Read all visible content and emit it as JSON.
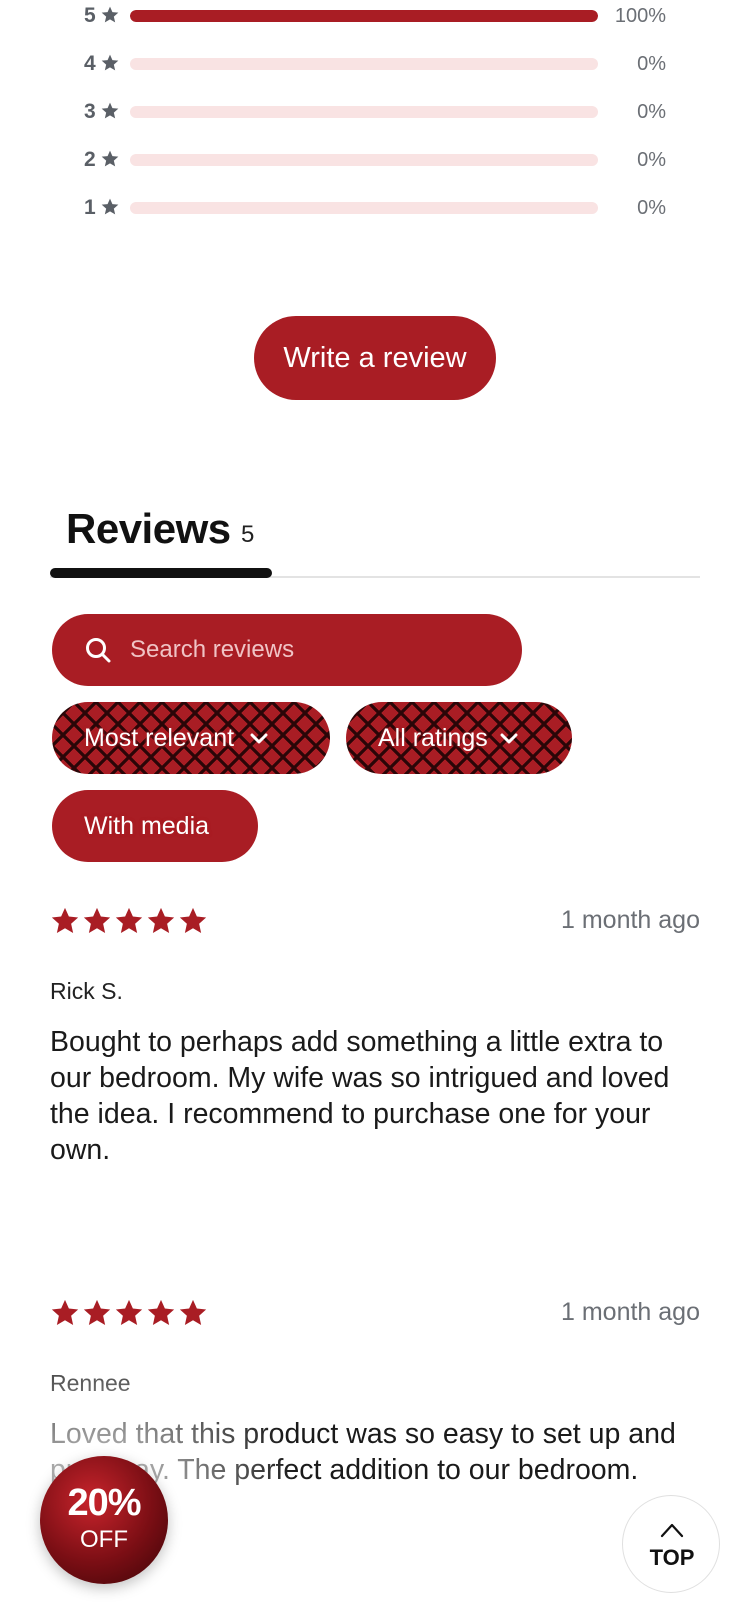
{
  "rating_distribution": [
    {
      "stars": "5",
      "percent_label": "100%",
      "fill": 1.0
    },
    {
      "stars": "4",
      "percent_label": "0%",
      "fill": 0
    },
    {
      "stars": "3",
      "percent_label": "0%",
      "fill": 0
    },
    {
      "stars": "2",
      "percent_label": "0%",
      "fill": 0
    },
    {
      "stars": "1",
      "percent_label": "0%",
      "fill": 0
    }
  ],
  "write_review_label": "Write a review",
  "reviews_tab": {
    "title": "Reviews",
    "count": "5"
  },
  "search": {
    "placeholder": "Search reviews",
    "icon": "search-icon"
  },
  "filters": {
    "sort_label": "Most relevant",
    "rating_label": "All ratings",
    "media_label": "With media"
  },
  "reviews": [
    {
      "rating": 5,
      "date": "1 month ago",
      "author": "Rick S.",
      "body": "Bought to perhaps add something a little extra to our bedroom. My wife was so intrigued and loved the idea. I recommend to purchase one for your own."
    },
    {
      "rating": 5,
      "date": "1 month ago",
      "author": "Rennee",
      "body": "Loved that this product was so easy to set up and put away. The perfect addition to our bedroom."
    }
  ],
  "promo": {
    "big": "20%",
    "small": "OFF"
  },
  "back_to_top": {
    "label": "TOP"
  },
  "colors": {
    "accent": "#a91d24",
    "bar_track": "#f9e3e3",
    "muted_text": "#6b6f75"
  }
}
